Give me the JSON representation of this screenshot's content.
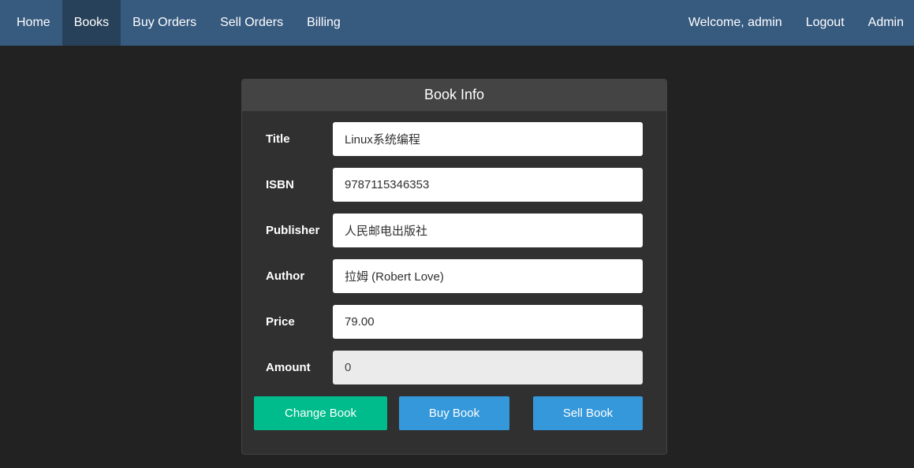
{
  "nav": {
    "left": [
      {
        "label": "Home",
        "active": false
      },
      {
        "label": "Books",
        "active": true
      },
      {
        "label": "Buy Orders",
        "active": false
      },
      {
        "label": "Sell Orders",
        "active": false
      },
      {
        "label": "Billing",
        "active": false
      }
    ],
    "welcome": "Welcome, admin",
    "logout": "Logout",
    "admin": "Admin"
  },
  "panel": {
    "title": "Book Info",
    "fields": {
      "title": {
        "label": "Title",
        "value": "Linux系统编程"
      },
      "isbn": {
        "label": "ISBN",
        "value": "9787115346353"
      },
      "publisher": {
        "label": "Publisher",
        "value": "人民邮电出版社"
      },
      "author": {
        "label": "Author",
        "value": "拉姆 (Robert Love)"
      },
      "price": {
        "label": "Price",
        "value": "79.00"
      },
      "amount": {
        "label": "Amount",
        "value": "0"
      }
    },
    "buttons": {
      "change": "Change Book",
      "buy": "Buy Book",
      "sell": "Sell Book"
    }
  },
  "colors": {
    "navbar": "#375a7f",
    "navbar_active": "#28415b",
    "background": "#222222",
    "panel": "#303030",
    "panel_heading": "#444444",
    "success": "#00bc8c",
    "info": "#3498db"
  }
}
